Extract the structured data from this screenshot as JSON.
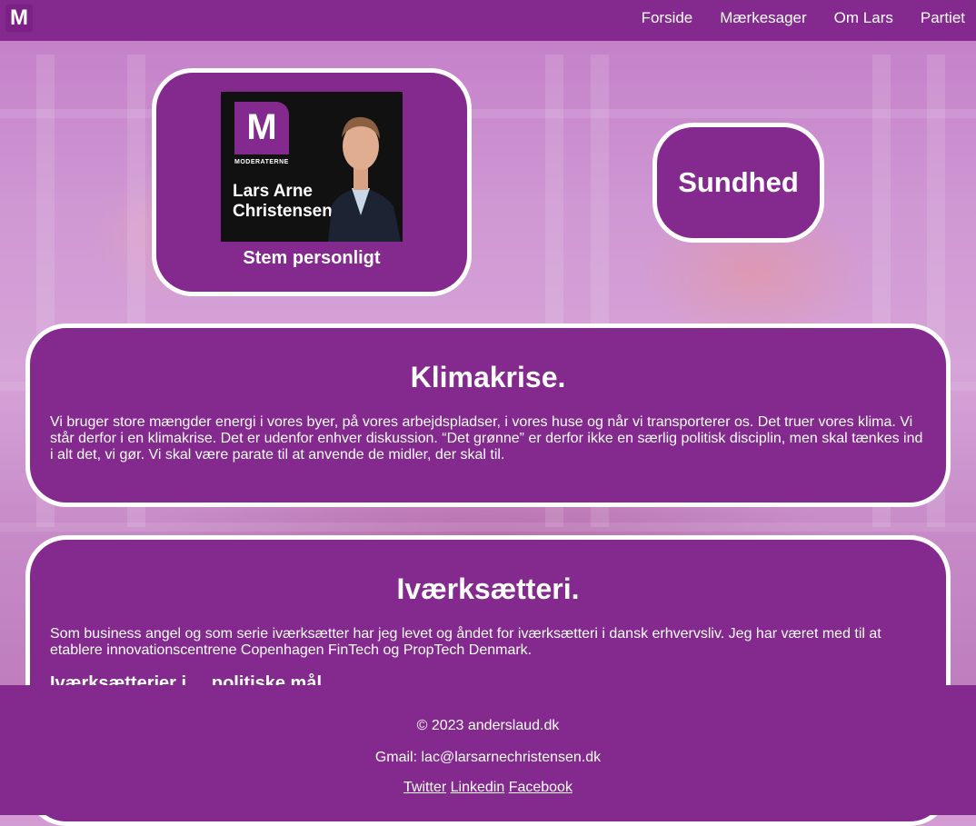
{
  "nav": {
    "logo": "M",
    "links": [
      "Forside",
      "Mærkesager",
      "Om Lars",
      "Partiet"
    ]
  },
  "hero": {
    "poster_logo": "M",
    "poster_party": "MODERATERNE",
    "poster_name": "Lars Arne Christensen",
    "cta": "Stem personligt"
  },
  "topic_button": "Sundhed",
  "sections": [
    {
      "title": "Klimakrise.",
      "body": "Vi bruger store mængder energi i vores byer, på vores arbejdspladser, i vores huse og når vi transporterer os. Det truer vores klima. Vi står derfor i en klimakrise. Det er udenfor enhver diskussion. “Det grønne” er derfor ikke en særlig politisk disciplin, men skal tænkes ind i alt det, vi gør. Vi skal være parate til at anvende de midler, der skal til."
    },
    {
      "title": "Iværksætteri.",
      "body": "Som business angel og som serie iværksætter har jeg levet og åndet for iværksætteri i dansk erhvervsliv. Jeg har været med til at etablere innovationscentrene Copenhagen FinTech og PropTech Denmark.",
      "subheading": "Iværksætterier i ... politiske mål"
    }
  ],
  "footer": {
    "copyright": "© 2023 anderslaud.dk",
    "email": "Gmail: lac@larsarnechristensen.dk",
    "social": [
      "Twitter",
      "Linkedin",
      "Facebook"
    ]
  },
  "colors": {
    "brand": "#842a8e",
    "border": "#ffffff"
  }
}
